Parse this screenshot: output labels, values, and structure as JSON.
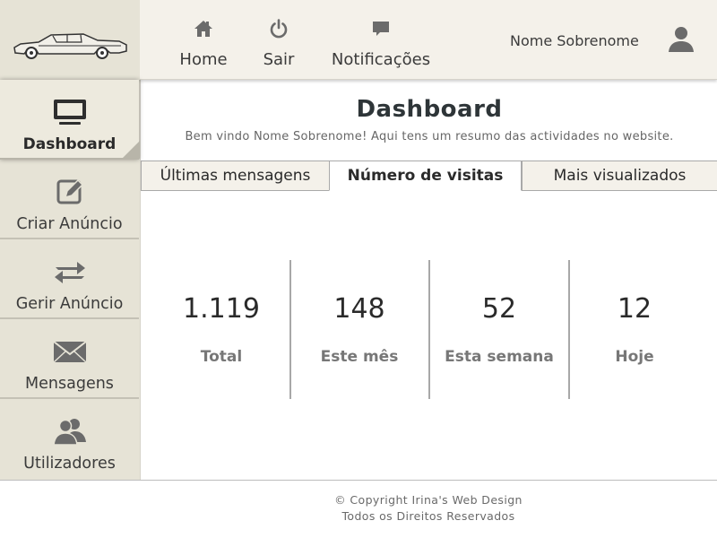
{
  "header": {
    "logo_icon": "vintage-car-icon",
    "nav": [
      {
        "label": "Home",
        "icon": "home-icon"
      },
      {
        "label": "Sair",
        "icon": "power-icon"
      },
      {
        "label": "Notificações",
        "icon": "chat-bubble-icon"
      }
    ],
    "user_name": "Nome Sobrenome",
    "user_icon": "user-icon"
  },
  "sidebar": {
    "items": [
      {
        "label": "Dashboard",
        "icon": "monitor-icon",
        "active": true
      },
      {
        "label": "Criar Anúncio",
        "icon": "edit-icon"
      },
      {
        "label": "Gerir Anúncio",
        "icon": "swap-arrows-icon"
      },
      {
        "label": "Mensagens",
        "icon": "envelope-icon"
      },
      {
        "label": "Utilizadores",
        "icon": "users-icon"
      }
    ]
  },
  "main": {
    "title": "Dashboard",
    "subtitle": "Bem vindo Nome Sobrenome! Aqui tens um resumo das actividades no website.",
    "tabs": [
      {
        "label": "Últimas mensagens"
      },
      {
        "label": "Número de visitas",
        "active": true
      },
      {
        "label": "Mais visualizados"
      }
    ],
    "stats": [
      {
        "value": "1.119",
        "label": "Total"
      },
      {
        "value": "148",
        "label": "Este mês"
      },
      {
        "value": "52",
        "label": "Esta semana"
      },
      {
        "value": "12",
        "label": "Hoje"
      }
    ]
  },
  "footer": {
    "copyright": "© Copyright Irina's Web Design",
    "rights": "Todos os Direitos Reservados"
  },
  "colors": {
    "header_bg": "#f4f1ea",
    "sidebar_bg": "#e6e3d6",
    "icon_gray": "#6b6b6b",
    "title_dark": "#2e3538"
  }
}
